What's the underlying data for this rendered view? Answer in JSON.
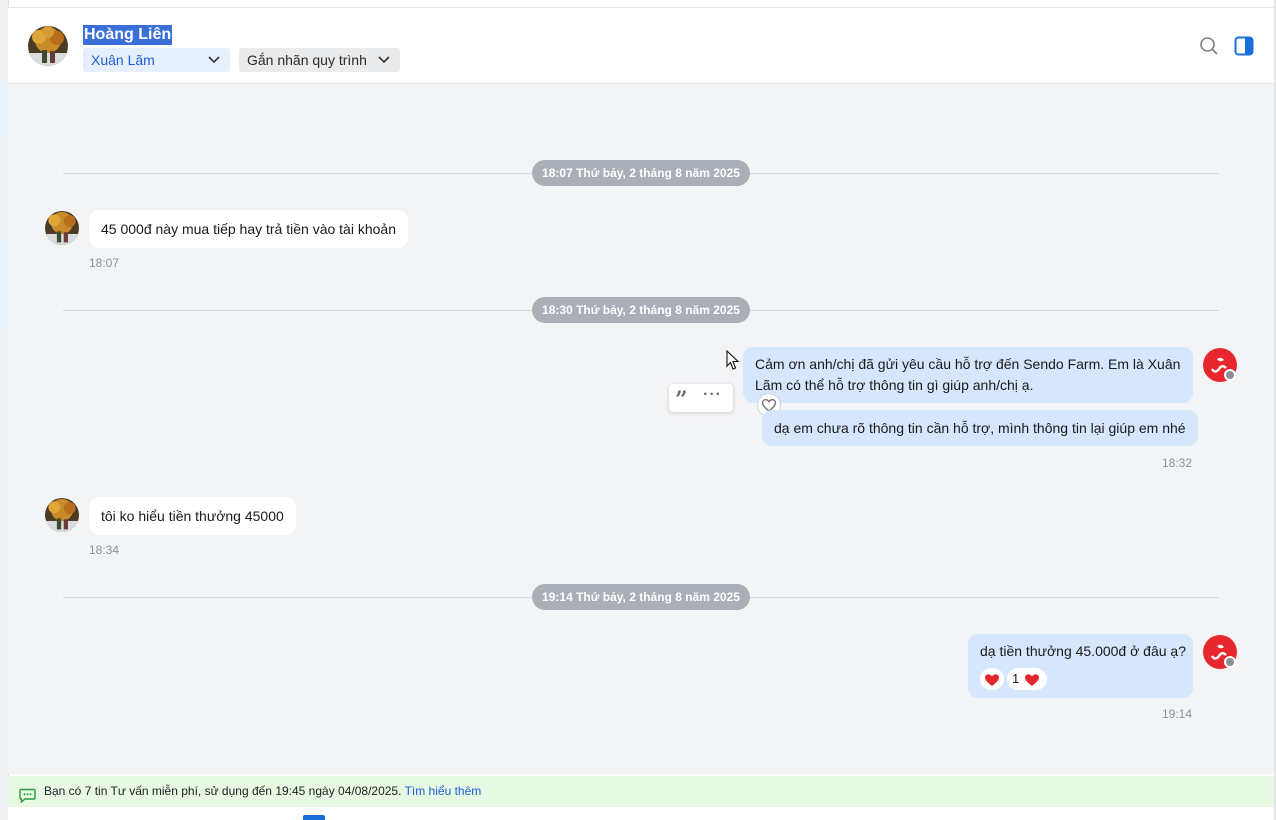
{
  "header": {
    "contact_name": "Hoàng Liên",
    "assignee": "Xuân Lãm",
    "tag_placeholder": "Gắn nhãn quy trình",
    "icons": [
      "search-icon",
      "panel-toggle-icon",
      "chevron-down-icon"
    ]
  },
  "messages": [
    {
      "type": "date",
      "label": "18:07 Thứ bảy, 2 tháng 8 năm 2025"
    },
    {
      "type": "in",
      "text": "45 000đ này mua tiếp hay trả tiền vào tài khoản",
      "time": "18:07"
    },
    {
      "type": "date",
      "label": "18:30 Thứ bảy, 2 tháng 8 năm 2025"
    },
    {
      "type": "out",
      "text": "Cảm ơn anh/chị đã gửi yêu cầu hỗ trợ đến Sendo Farm. Em là Xuân Lãm có thể hỗ trợ thông tin gì giúp anh/chị ạ."
    },
    {
      "type": "out",
      "text": "dạ em chưa rõ thông tin cần hỗ trợ, mình thông tin lại giúp em nhé",
      "time": "18:32"
    },
    {
      "type": "in",
      "text": "tôi ko hiểu tiền thưởng 45000",
      "time": "18:34"
    },
    {
      "type": "date",
      "label": "19:14 Thứ bảy, 2 tháng 8 năm 2025"
    },
    {
      "type": "out",
      "text": "dạ tiền thưởng 45.000đ ở đâu ạ?",
      "time": "19:14",
      "reaction_count": "1"
    }
  ],
  "banner": {
    "text": "Bạn có 7 tin Tư vấn miễn phí, sử dụng đến 19:45 ngày 04/08/2025.",
    "link": "Tìm hiểu thêm"
  },
  "colors": {
    "accent": "#1b5fd6",
    "out_bubble": "#d6e6fd",
    "in_bubble": "#ffffff",
    "chat_bg": "#f3f4f6",
    "date_pill": "#a9aeb7",
    "banner_bg": "#e7f9e3",
    "shop_logo": "#e8262d"
  }
}
